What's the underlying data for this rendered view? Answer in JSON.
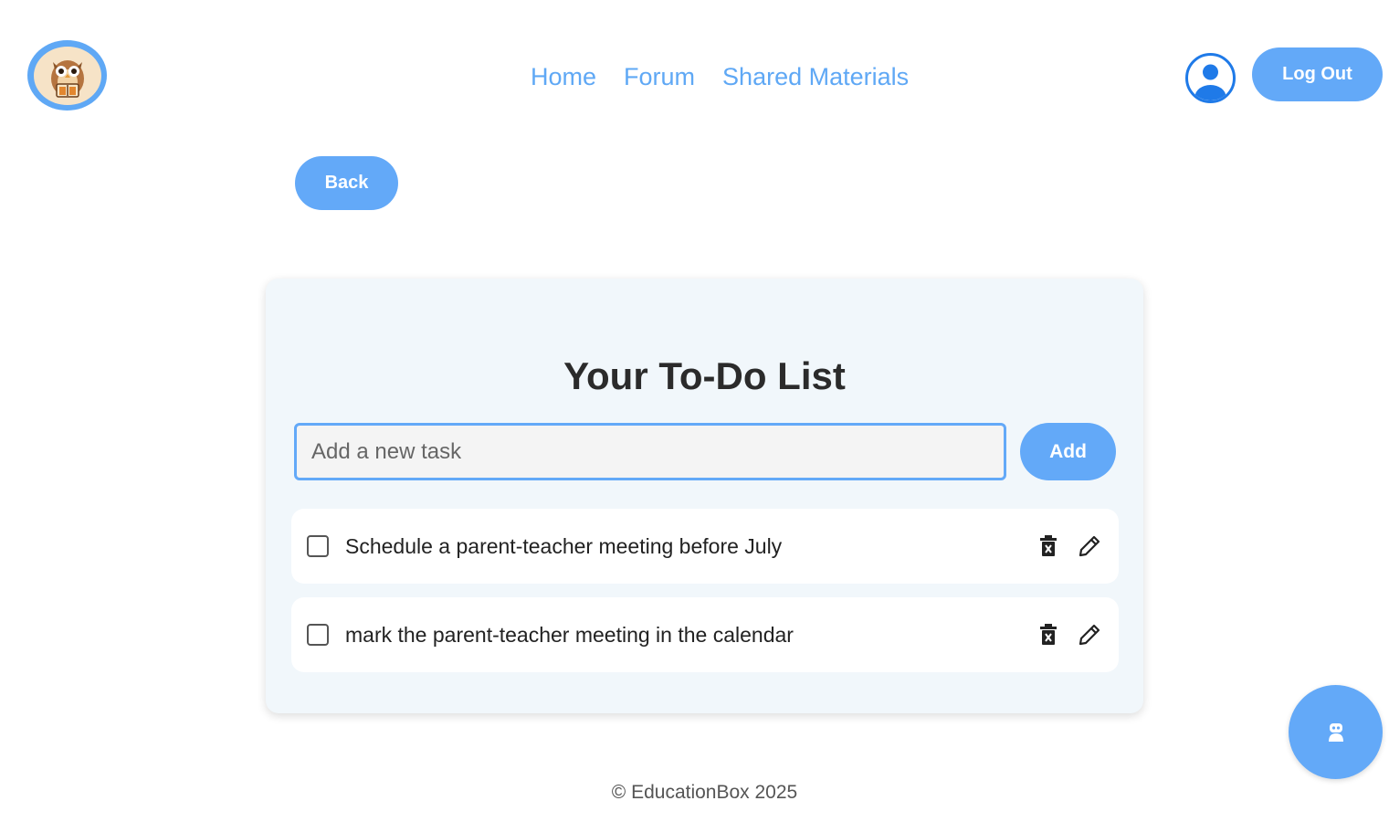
{
  "header": {
    "logo_icon": "owl-reading-book-icon",
    "nav": [
      {
        "label": "Home"
      },
      {
        "label": "Forum"
      },
      {
        "label": "Shared Materials"
      }
    ],
    "profile_icon": "user-circle-icon",
    "logout_label": "Log Out"
  },
  "back_label": "Back",
  "todo": {
    "title": "Your To-Do List",
    "input_placeholder": "Add a new task",
    "input_value": "",
    "add_label": "Add",
    "tasks": [
      {
        "text": "Schedule a parent-teacher meeting before July",
        "done": false
      },
      {
        "text": "mark the parent-teacher meeting in the calendar",
        "done": false
      }
    ]
  },
  "footer": {
    "text": "© EducationBox 2025"
  },
  "chatbot_icon": "robot-icon",
  "colors": {
    "accent": "#63a9f8",
    "link": "#5fa8f5",
    "profile": "#1f7ae8",
    "card_bg": "#f1f7fb"
  }
}
